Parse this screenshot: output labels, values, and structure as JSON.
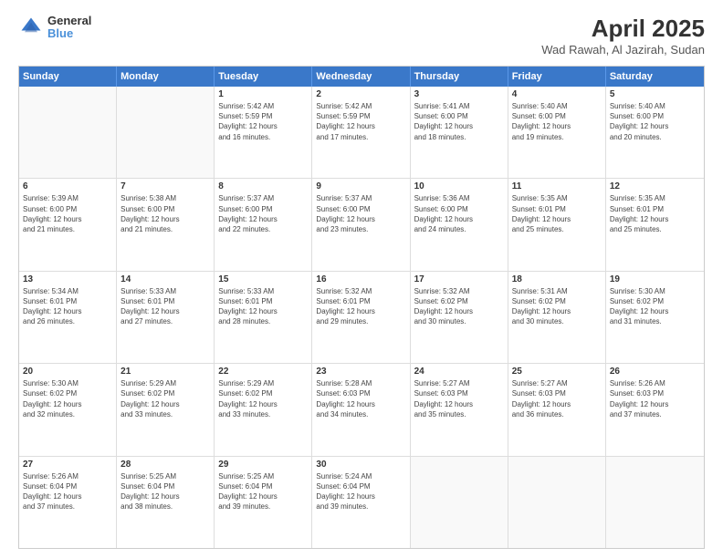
{
  "header": {
    "logo_line1": "General",
    "logo_line2": "Blue",
    "title": "April 2025",
    "subtitle": "Wad Rawah, Al Jazirah, Sudan"
  },
  "calendar": {
    "days_of_week": [
      "Sunday",
      "Monday",
      "Tuesday",
      "Wednesday",
      "Thursday",
      "Friday",
      "Saturday"
    ],
    "rows": [
      [
        {
          "day": "",
          "lines": [],
          "empty": true
        },
        {
          "day": "",
          "lines": [],
          "empty": true
        },
        {
          "day": "1",
          "lines": [
            "Sunrise: 5:42 AM",
            "Sunset: 5:59 PM",
            "Daylight: 12 hours",
            "and 16 minutes."
          ]
        },
        {
          "day": "2",
          "lines": [
            "Sunrise: 5:42 AM",
            "Sunset: 5:59 PM",
            "Daylight: 12 hours",
            "and 17 minutes."
          ]
        },
        {
          "day": "3",
          "lines": [
            "Sunrise: 5:41 AM",
            "Sunset: 6:00 PM",
            "Daylight: 12 hours",
            "and 18 minutes."
          ]
        },
        {
          "day": "4",
          "lines": [
            "Sunrise: 5:40 AM",
            "Sunset: 6:00 PM",
            "Daylight: 12 hours",
            "and 19 minutes."
          ]
        },
        {
          "day": "5",
          "lines": [
            "Sunrise: 5:40 AM",
            "Sunset: 6:00 PM",
            "Daylight: 12 hours",
            "and 20 minutes."
          ]
        }
      ],
      [
        {
          "day": "6",
          "lines": [
            "Sunrise: 5:39 AM",
            "Sunset: 6:00 PM",
            "Daylight: 12 hours",
            "and 21 minutes."
          ]
        },
        {
          "day": "7",
          "lines": [
            "Sunrise: 5:38 AM",
            "Sunset: 6:00 PM",
            "Daylight: 12 hours",
            "and 21 minutes."
          ]
        },
        {
          "day": "8",
          "lines": [
            "Sunrise: 5:37 AM",
            "Sunset: 6:00 PM",
            "Daylight: 12 hours",
            "and 22 minutes."
          ]
        },
        {
          "day": "9",
          "lines": [
            "Sunrise: 5:37 AM",
            "Sunset: 6:00 PM",
            "Daylight: 12 hours",
            "and 23 minutes."
          ]
        },
        {
          "day": "10",
          "lines": [
            "Sunrise: 5:36 AM",
            "Sunset: 6:00 PM",
            "Daylight: 12 hours",
            "and 24 minutes."
          ]
        },
        {
          "day": "11",
          "lines": [
            "Sunrise: 5:35 AM",
            "Sunset: 6:01 PM",
            "Daylight: 12 hours",
            "and 25 minutes."
          ]
        },
        {
          "day": "12",
          "lines": [
            "Sunrise: 5:35 AM",
            "Sunset: 6:01 PM",
            "Daylight: 12 hours",
            "and 25 minutes."
          ]
        }
      ],
      [
        {
          "day": "13",
          "lines": [
            "Sunrise: 5:34 AM",
            "Sunset: 6:01 PM",
            "Daylight: 12 hours",
            "and 26 minutes."
          ]
        },
        {
          "day": "14",
          "lines": [
            "Sunrise: 5:33 AM",
            "Sunset: 6:01 PM",
            "Daylight: 12 hours",
            "and 27 minutes."
          ]
        },
        {
          "day": "15",
          "lines": [
            "Sunrise: 5:33 AM",
            "Sunset: 6:01 PM",
            "Daylight: 12 hours",
            "and 28 minutes."
          ]
        },
        {
          "day": "16",
          "lines": [
            "Sunrise: 5:32 AM",
            "Sunset: 6:01 PM",
            "Daylight: 12 hours",
            "and 29 minutes."
          ]
        },
        {
          "day": "17",
          "lines": [
            "Sunrise: 5:32 AM",
            "Sunset: 6:02 PM",
            "Daylight: 12 hours",
            "and 30 minutes."
          ]
        },
        {
          "day": "18",
          "lines": [
            "Sunrise: 5:31 AM",
            "Sunset: 6:02 PM",
            "Daylight: 12 hours",
            "and 30 minutes."
          ]
        },
        {
          "day": "19",
          "lines": [
            "Sunrise: 5:30 AM",
            "Sunset: 6:02 PM",
            "Daylight: 12 hours",
            "and 31 minutes."
          ]
        }
      ],
      [
        {
          "day": "20",
          "lines": [
            "Sunrise: 5:30 AM",
            "Sunset: 6:02 PM",
            "Daylight: 12 hours",
            "and 32 minutes."
          ]
        },
        {
          "day": "21",
          "lines": [
            "Sunrise: 5:29 AM",
            "Sunset: 6:02 PM",
            "Daylight: 12 hours",
            "and 33 minutes."
          ]
        },
        {
          "day": "22",
          "lines": [
            "Sunrise: 5:29 AM",
            "Sunset: 6:02 PM",
            "Daylight: 12 hours",
            "and 33 minutes."
          ]
        },
        {
          "day": "23",
          "lines": [
            "Sunrise: 5:28 AM",
            "Sunset: 6:03 PM",
            "Daylight: 12 hours",
            "and 34 minutes."
          ]
        },
        {
          "day": "24",
          "lines": [
            "Sunrise: 5:27 AM",
            "Sunset: 6:03 PM",
            "Daylight: 12 hours",
            "and 35 minutes."
          ]
        },
        {
          "day": "25",
          "lines": [
            "Sunrise: 5:27 AM",
            "Sunset: 6:03 PM",
            "Daylight: 12 hours",
            "and 36 minutes."
          ]
        },
        {
          "day": "26",
          "lines": [
            "Sunrise: 5:26 AM",
            "Sunset: 6:03 PM",
            "Daylight: 12 hours",
            "and 37 minutes."
          ]
        }
      ],
      [
        {
          "day": "27",
          "lines": [
            "Sunrise: 5:26 AM",
            "Sunset: 6:04 PM",
            "Daylight: 12 hours",
            "and 37 minutes."
          ]
        },
        {
          "day": "28",
          "lines": [
            "Sunrise: 5:25 AM",
            "Sunset: 6:04 PM",
            "Daylight: 12 hours",
            "and 38 minutes."
          ]
        },
        {
          "day": "29",
          "lines": [
            "Sunrise: 5:25 AM",
            "Sunset: 6:04 PM",
            "Daylight: 12 hours",
            "and 39 minutes."
          ]
        },
        {
          "day": "30",
          "lines": [
            "Sunrise: 5:24 AM",
            "Sunset: 6:04 PM",
            "Daylight: 12 hours",
            "and 39 minutes."
          ]
        },
        {
          "day": "",
          "lines": [],
          "empty": true
        },
        {
          "day": "",
          "lines": [],
          "empty": true
        },
        {
          "day": "",
          "lines": [],
          "empty": true
        }
      ]
    ]
  }
}
